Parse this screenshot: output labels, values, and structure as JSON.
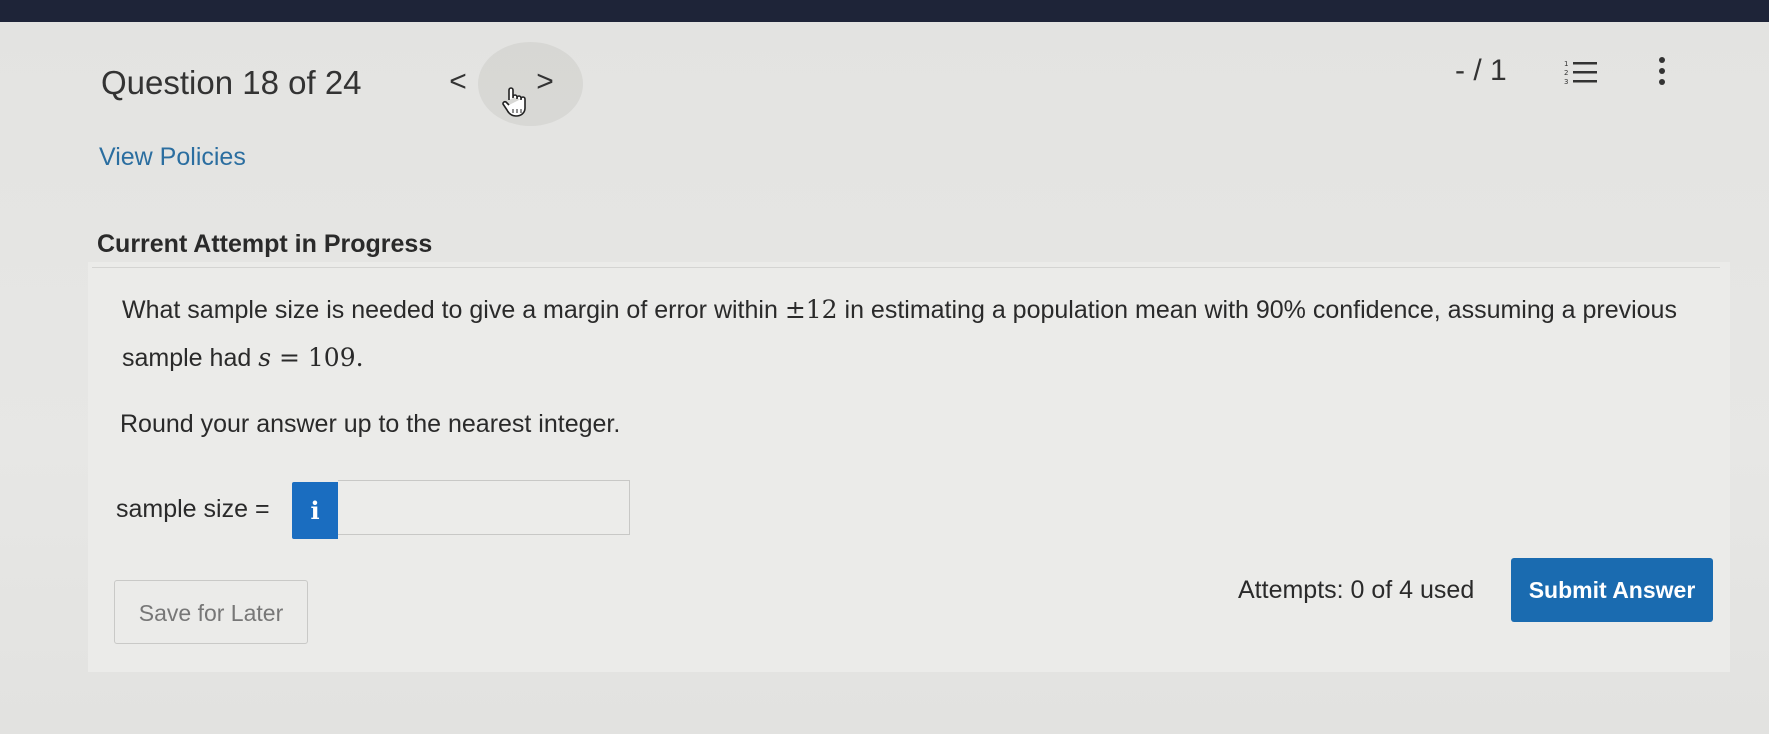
{
  "header": {
    "question_counter": "Question 18 of 24",
    "prev_label": "<",
    "next_label": ">",
    "score": "- / 1"
  },
  "links": {
    "view_policies": "View Policies"
  },
  "attempt": {
    "heading": "Current Attempt in Progress"
  },
  "question": {
    "text_part1": "What sample size is needed to give a margin of error within ",
    "pm_symbol": "±",
    "margin_value": "12",
    "text_part2": " in estimating a population mean with 90% confidence, assuming a previous sample had ",
    "s_var": "s",
    "equals": " = ",
    "s_value": "109.",
    "instruction": "Round your answer up to the nearest integer."
  },
  "answer": {
    "label": "sample size =",
    "info_label": "i",
    "value": ""
  },
  "footer": {
    "save_label": "Save for Later",
    "attempts_text": "Attempts: 0 of 4 used",
    "submit_label": "Submit Answer"
  },
  "colors": {
    "accent": "#1a6bb0",
    "link": "#2b6ea0",
    "info_button": "#1a6dc0"
  },
  "icons": {
    "list": "numbered-list-icon",
    "more": "vertical-ellipsis-icon",
    "cursor": "hand-pointer-icon"
  }
}
